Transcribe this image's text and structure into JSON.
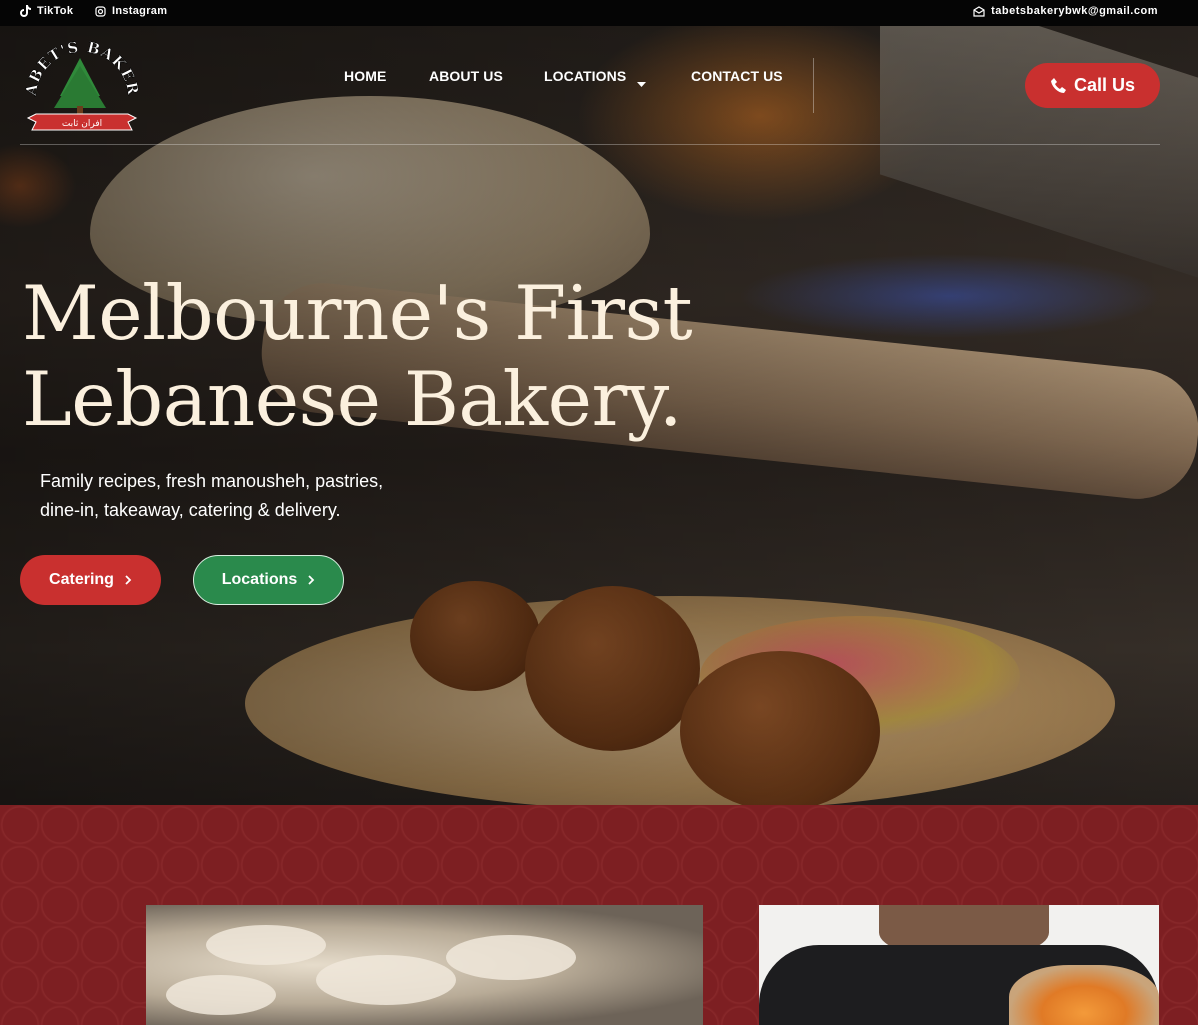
{
  "topbar": {
    "tiktok": "TikTok",
    "instagram": "Instagram",
    "email": "tabetsbakerybwk@gmail.com"
  },
  "logo": {
    "text": "TABET'S BAKERY",
    "arabic": "افران ثابت"
  },
  "nav": {
    "home": "HOME",
    "about": "ABOUT US",
    "locations": "LOCATIONS",
    "contact": "CONTACT US"
  },
  "call_button": "Call Us",
  "hero": {
    "headline_line1": "Melbourne's First",
    "headline_line2": "Lebanese Bakery.",
    "subtext_line1": "Family recipes, fresh manousheh, pastries,",
    "subtext_line2": "dine-in, takeaway, catering & delivery.",
    "catering_label": "Catering",
    "locations_label": "Locations"
  },
  "colors": {
    "brand_red": "#c9302f",
    "brand_green": "#2a8a4c",
    "cream": "#fbf0de",
    "section_red": "#7d1f22"
  }
}
